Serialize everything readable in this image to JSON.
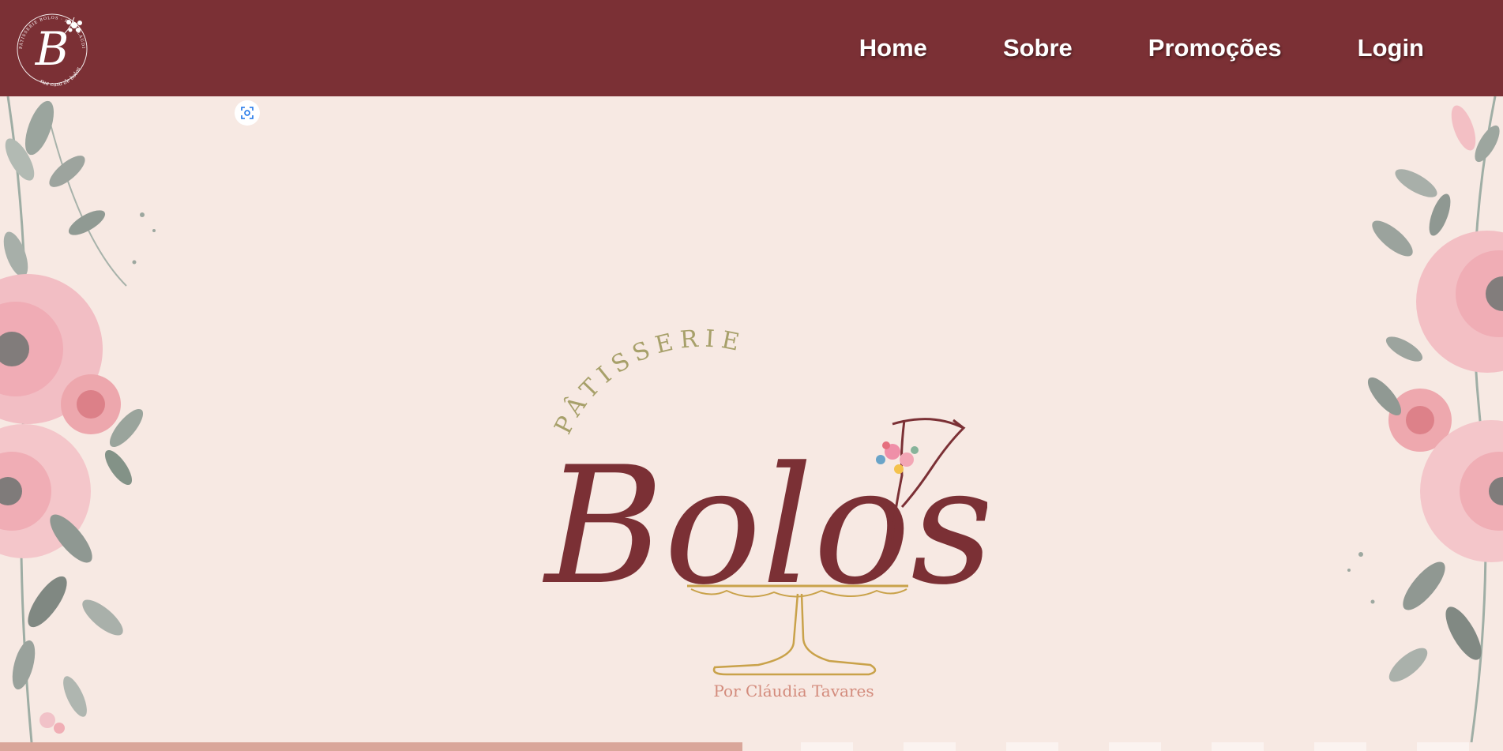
{
  "nav": {
    "logo_letter": "B",
    "logo_ring_text": "PÂTISSERIE BOLOS · POR CLÁUDIA TAVARES",
    "logo_bottom_text": "sua casa de bolos",
    "links": [
      {
        "label": "Home"
      },
      {
        "label": "Sobre"
      },
      {
        "label": "Promoções"
      },
      {
        "label": "Login"
      }
    ]
  },
  "hero": {
    "logo_arc_text": "PÂTISSERIE",
    "logo_script_text": "Bolos",
    "logo_byline": "Por Cláudia Tavares",
    "lens_icon": "image-search-icon"
  },
  "colors": {
    "brand": "#7b3035",
    "background": "#f7e9e3",
    "gold": "#c9a24a",
    "olive": "#a7a06a",
    "byline": "#d38b7c",
    "strip": "#d9a69a"
  }
}
